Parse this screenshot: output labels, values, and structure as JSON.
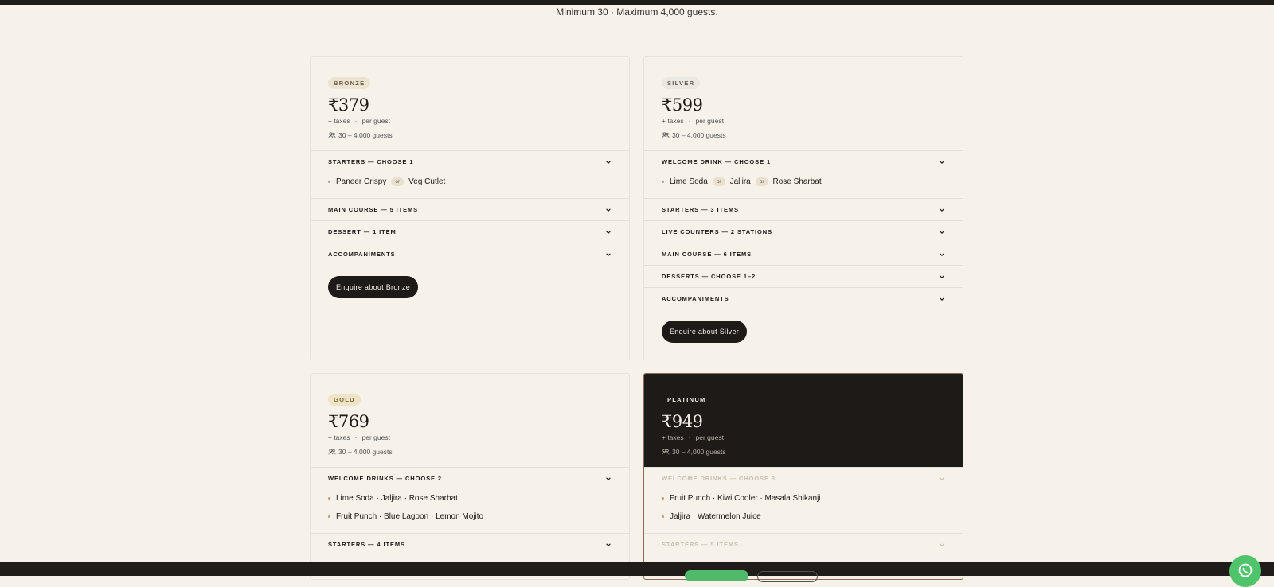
{
  "subtitle": "Minimum 30 · Maximum 4,000 guests.",
  "colors": {
    "background": "#f6f1e9",
    "dark": "#1d1a17",
    "accent_bullet": "#c39a6c",
    "whatsapp": "#4fc46a"
  },
  "cards": [
    {
      "tier": "BRONZE",
      "price": "₹379",
      "taxes": "+ taxes",
      "per_guest": "per guest",
      "guests": "30 – 4,000 guests",
      "sections": [
        {
          "title": "STARTERS — CHOOSE 1",
          "rows": [
            [
              "Paneer Crispy",
              "or",
              "Veg Cutlet"
            ]
          ]
        },
        {
          "title": "MAIN COURSE — 5 ITEMS"
        },
        {
          "title": "DESSERT — 1 ITEM"
        },
        {
          "title": "ACCOMPANIMENTS"
        }
      ],
      "button": "Enquire about Bronze"
    },
    {
      "tier": "SILVER",
      "price": "₹599",
      "taxes": "+ taxes",
      "per_guest": "per guest",
      "guests": "30 – 4,000 guests",
      "sections": [
        {
          "title": "WELCOME DRINK — CHOOSE 1",
          "rows": [
            [
              "Lime Soda",
              "or",
              "Jaljira",
              "or",
              "Rose Sharbat"
            ]
          ]
        },
        {
          "title": "STARTERS — 3 ITEMS"
        },
        {
          "title": "LIVE COUNTERS — 2 STATIONS"
        },
        {
          "title": "MAIN COURSE — 6 ITEMS"
        },
        {
          "title": "DESSERTS — CHOOSE 1–2"
        },
        {
          "title": "ACCOMPANIMENTS"
        }
      ],
      "button": "Enquire about Silver"
    },
    {
      "tier": "GOLD",
      "price": "₹769",
      "taxes": "+ taxes",
      "per_guest": "per guest",
      "guests": "30 – 4,000 guests",
      "sections": [
        {
          "title": "WELCOME DRINKS — CHOOSE 2",
          "rows": [
            "Lime Soda · Jaljira · Rose Sharbat",
            "Fruit Punch · Blue Lagoon · Lemon Mojito"
          ]
        },
        {
          "title": "STARTERS — 4 ITEMS"
        }
      ]
    },
    {
      "tier": "PLATINUM",
      "price": "₹949",
      "taxes": "+ taxes",
      "per_guest": "per guest",
      "guests": "30 – 4,000 guests",
      "sections": [
        {
          "title": "WELCOME DRINKS — CHOOSE 3",
          "rows": [
            "Fruit Punch · Kiwi Cooler · Masala Shikanji",
            "Jaljira · Watermelon Juice"
          ]
        },
        {
          "title": "STARTERS — 5 ITEMS"
        }
      ]
    }
  ]
}
